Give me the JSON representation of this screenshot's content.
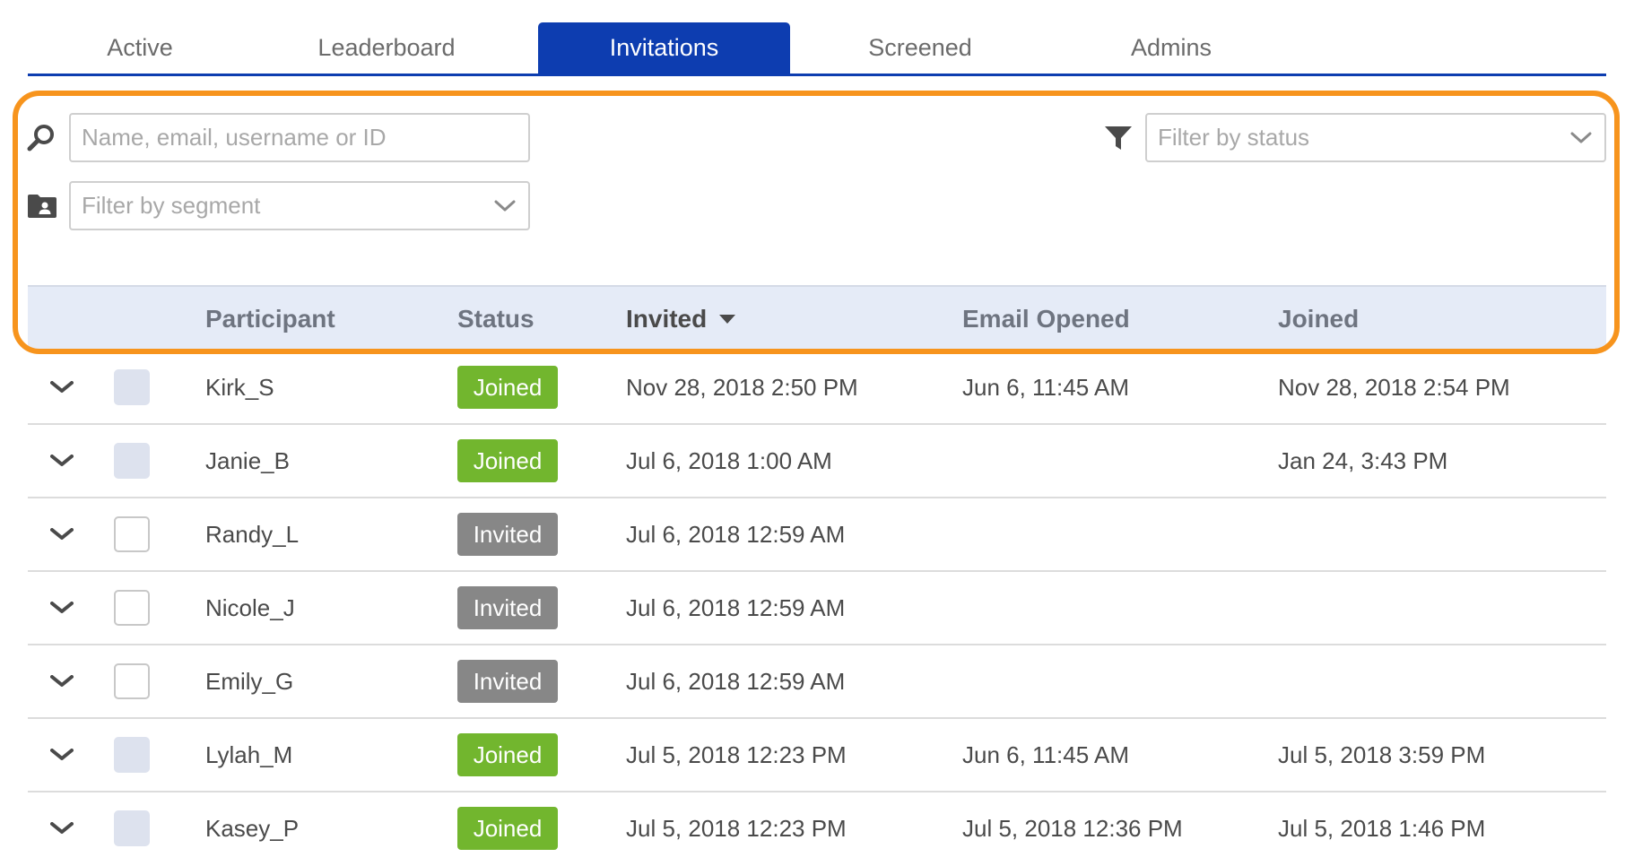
{
  "tabs": [
    {
      "label": "Active"
    },
    {
      "label": "Leaderboard"
    },
    {
      "label": "Invitations"
    },
    {
      "label": "Screened"
    },
    {
      "label": "Admins"
    }
  ],
  "active_tab": "Invitations",
  "filters": {
    "search_placeholder": "Name, email, username or ID",
    "status_placeholder": "Filter by status",
    "segment_placeholder": "Filter by segment"
  },
  "icons": {
    "search": "search-icon",
    "filter": "funnel-filter-icon",
    "segment": "folder-user-icon",
    "expand": "chevron-down-icon",
    "sort": "caret-down-icon"
  },
  "table": {
    "headers": {
      "participant": "Participant",
      "status": "Status",
      "invited": "Invited",
      "email_opened": "Email Opened",
      "joined": "Joined"
    },
    "sorted_by": "Invited",
    "sort_direction": "descending",
    "rows": [
      {
        "name": "Kirk_S",
        "status": "Joined",
        "invited": "Nov 28, 2018 2:50 PM",
        "email_opened": "Jun 6, 11:45 AM",
        "joined": "Nov 28, 2018 2:54 PM",
        "checkbox": "disabled"
      },
      {
        "name": "Janie_B",
        "status": "Joined",
        "invited": "Jul 6, 2018 1:00 AM",
        "email_opened": "",
        "joined": "Jan 24, 3:43 PM",
        "checkbox": "disabled"
      },
      {
        "name": "Randy_L",
        "status": "Invited",
        "invited": "Jul 6, 2018 12:59 AM",
        "email_opened": "",
        "joined": "",
        "checkbox": "unchecked"
      },
      {
        "name": "Nicole_J",
        "status": "Invited",
        "invited": "Jul 6, 2018 12:59 AM",
        "email_opened": "",
        "joined": "",
        "checkbox": "unchecked"
      },
      {
        "name": "Emily_G",
        "status": "Invited",
        "invited": "Jul 6, 2018 12:59 AM",
        "email_opened": "",
        "joined": "",
        "checkbox": "unchecked"
      },
      {
        "name": "Lylah_M",
        "status": "Joined",
        "invited": "Jul 5, 2018 12:23 PM",
        "email_opened": "Jun 6, 11:45 AM",
        "joined": "Jul 5, 2018 3:59 PM",
        "checkbox": "disabled"
      },
      {
        "name": "Kasey_P",
        "status": "Joined",
        "invited": "Jul 5, 2018 12:23 PM",
        "email_opened": "Jul 5, 2018 12:36 PM",
        "joined": "Jul 5, 2018 1:46 PM",
        "checkbox": "disabled"
      }
    ]
  },
  "colors": {
    "primary": "#0d3db0",
    "joined_badge": "#72b62e",
    "invited_badge": "#878787",
    "highlight": "#f7941d",
    "header_bg": "#e5ebf7"
  }
}
